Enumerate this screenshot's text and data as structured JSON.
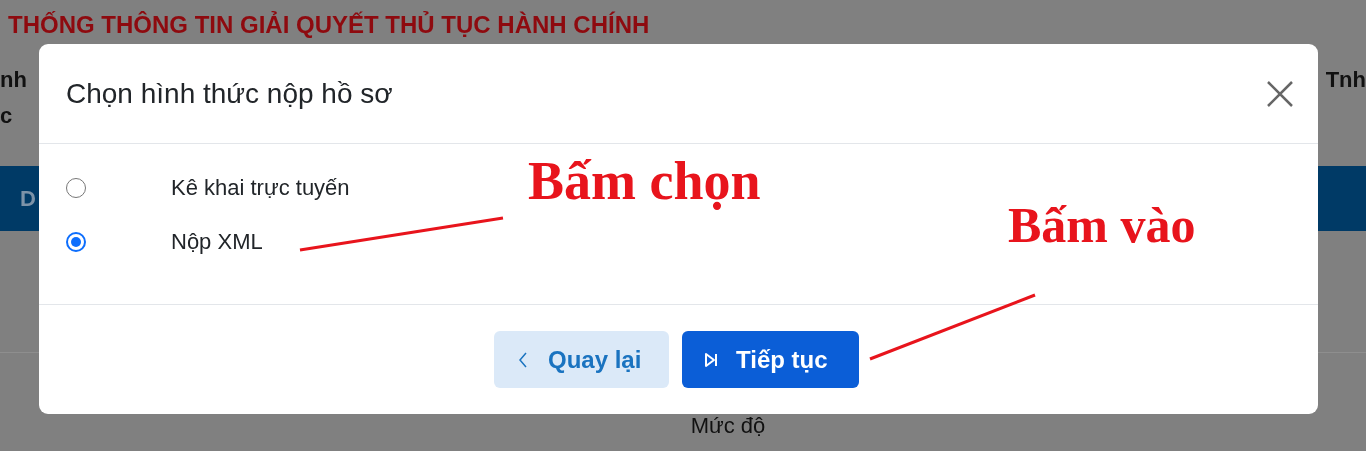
{
  "background": {
    "title": "THỐNG THÔNG TIN GIẢI QUYẾT THỦ TỤC HÀNH CHÍNH",
    "line_1_left": "nh",
    "line_1_right": "Tnh",
    "line_2_left": "c",
    "nav_text": "D",
    "column_header": "Mức độ"
  },
  "dialog": {
    "title": "Chọn hình thức nộp hồ sơ",
    "options": [
      {
        "label": "Kê khai trực tuyến",
        "selected": false
      },
      {
        "label": "Nộp XML",
        "selected": true
      }
    ],
    "buttons": [
      {
        "label": "Quay lại",
        "kind": "back"
      },
      {
        "label": "Tiếp tục",
        "kind": "next"
      }
    ]
  },
  "annotations": [
    {
      "text": "Bấm chọn"
    },
    {
      "text": "Bấm vào"
    }
  ]
}
